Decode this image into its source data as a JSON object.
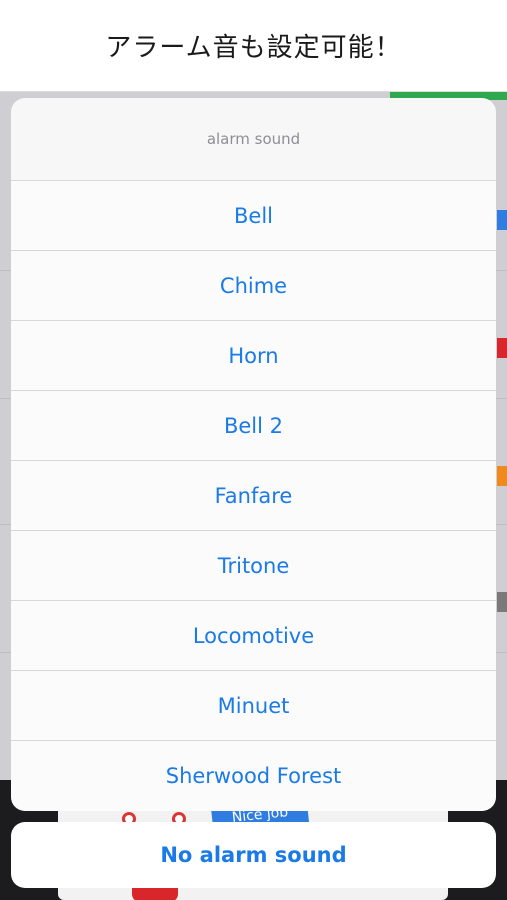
{
  "caption": "アラーム音も設定可能！",
  "sheet": {
    "title": "alarm sound",
    "options": [
      "Bell",
      "Chime",
      "Horn",
      "Bell 2",
      "Fanfare",
      "Tritone",
      "Locomotive",
      "Minuet",
      "Sherwood Forest"
    ]
  },
  "cancel_label": "No alarm sound",
  "background": {
    "sticker_text": "Nice job"
  },
  "colors": {
    "accent": "#1a7ae6",
    "title_text": "#8e8e93"
  }
}
